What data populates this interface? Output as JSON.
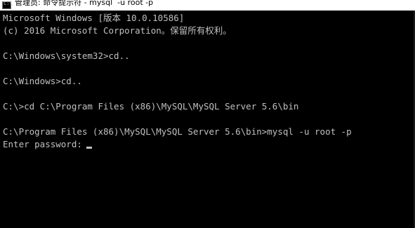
{
  "window": {
    "title": "管理员: 命令提示符 - mysql  -u root -p",
    "icon": "cmd-icon",
    "icon_glyph": "C:\\"
  },
  "colors": {
    "background": "#000000",
    "text": "#c0c0c0",
    "titlebar": "#ffffff"
  },
  "console": {
    "lines": [
      "Microsoft Windows [版本 10.0.10586]",
      "(c) 2016 Microsoft Corporation。保留所有权利。",
      "",
      "C:\\Windows\\system32>cd..",
      "",
      "C:\\Windows>cd..",
      "",
      "C:\\>cd C:\\Program Files (x86)\\MySQL\\MySQL Server 5.6\\bin",
      "",
      "C:\\Program Files (x86)\\MySQL\\MySQL Server 5.6\\bin>mysql -u root -p",
      "Enter password:"
    ]
  }
}
